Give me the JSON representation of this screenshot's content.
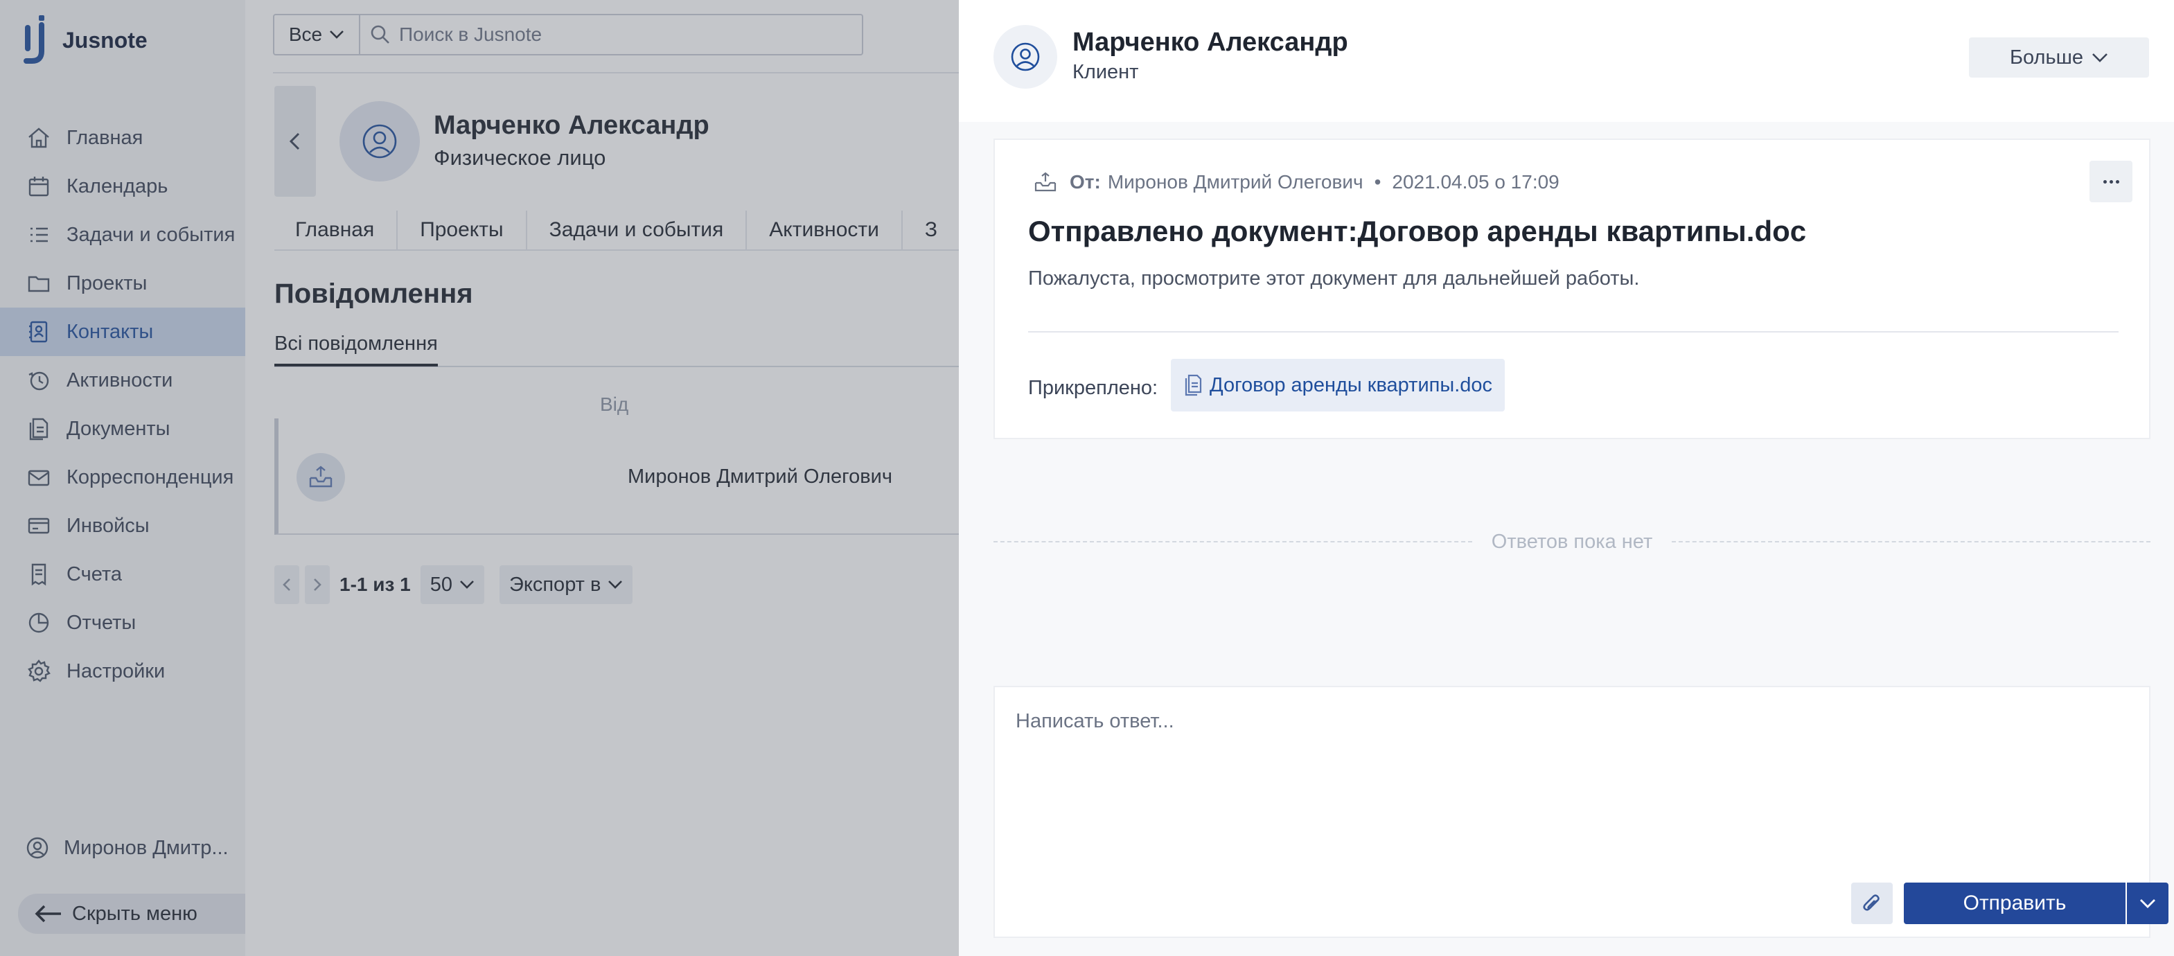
{
  "app": {
    "name": "Jusnote"
  },
  "sidebar": {
    "items": [
      {
        "label": "Главная",
        "icon": "home-icon",
        "active": false
      },
      {
        "label": "Календарь",
        "icon": "calendar-icon",
        "active": false
      },
      {
        "label": "Задачи и события",
        "icon": "tasks-icon",
        "active": false
      },
      {
        "label": "Проекты",
        "icon": "folder-icon",
        "active": false
      },
      {
        "label": "Контакты",
        "icon": "contacts-icon",
        "active": true
      },
      {
        "label": "Активности",
        "icon": "activity-icon",
        "active": false
      },
      {
        "label": "Документы",
        "icon": "documents-icon",
        "active": false
      },
      {
        "label": "Корреспонденция",
        "icon": "mail-icon",
        "active": false
      },
      {
        "label": "Инвойсы",
        "icon": "invoice-icon",
        "active": false
      },
      {
        "label": "Счета",
        "icon": "bill-icon",
        "active": false
      },
      {
        "label": "Отчеты",
        "icon": "reports-icon",
        "active": false
      },
      {
        "label": "Настройки",
        "icon": "gear-icon",
        "active": false
      }
    ],
    "user": "Миронов Дмитр...",
    "hide_menu": "Скрыть меню"
  },
  "search": {
    "filter": "Все",
    "placeholder": "Поиск в Jusnote"
  },
  "contact": {
    "name": "Марченко Александр",
    "type": "Физическое лицо",
    "tabs": [
      "Главная",
      "Проекты",
      "Задачи и события",
      "Активности",
      "З"
    ]
  },
  "messages": {
    "title": "Повідомлення",
    "subtab": "Всі повідомлення",
    "col_from": "Від",
    "rows": [
      {
        "from": "Миронов Дмитрий Олегович"
      }
    ]
  },
  "pager": {
    "range": "1-1 из 1",
    "page_size": "50",
    "export": "Экспорт в"
  },
  "drawer": {
    "name": "Марченко Александр",
    "role": "Клиент",
    "more": "Больше",
    "message": {
      "from_label": "От:",
      "from": "Миронов Дмитрий Олегович",
      "separator": "•",
      "date": "2021.04.05 о 17:09",
      "subject": "Отправлено документ:Договор аренды квартипы.doc",
      "body": "Пожалуста, просмотрите этот документ для дальнейшей работы.",
      "attached_label": "Прикреплено:",
      "attachment": "Договор аренды квартипы.doc"
    },
    "no_replies": "Ответов пока нет",
    "reply": {
      "placeholder": "Написать ответ...",
      "send": "Отправить"
    }
  },
  "colors": {
    "accent": "#23489a",
    "active_nav_bg": "#c9d6ec",
    "link": "#1f4e9c"
  }
}
